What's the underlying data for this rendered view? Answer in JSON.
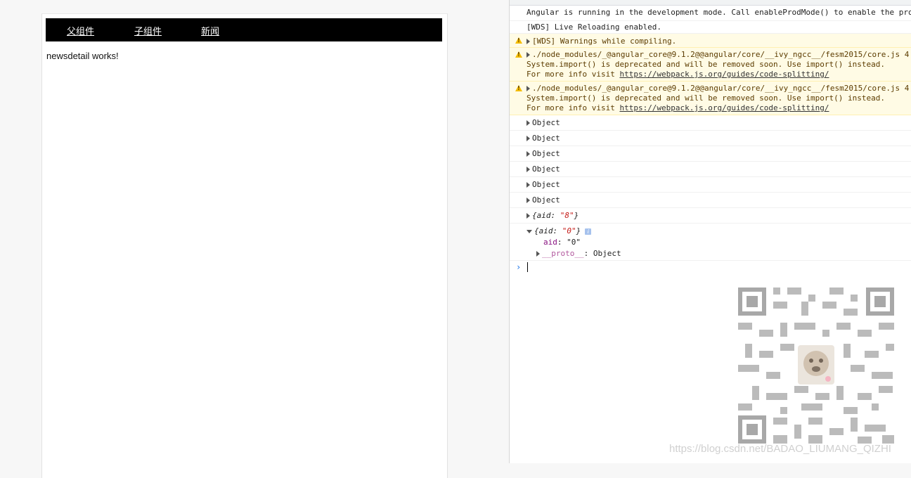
{
  "app": {
    "nav": {
      "parent_label": "父组件",
      "child_label": "子组件",
      "news_label": "新闻"
    },
    "content_text": "newsdetail works!"
  },
  "console": {
    "messages": {
      "dev_mode": "Angular is running in the development mode. Call enableProdMode() to enable the pro",
      "live_reload": "[WDS] Live Reloading enabled.",
      "wds_warnings": "[WDS] Warnings while compiling.",
      "warn1_line1": "./node_modules/_@angular_core@9.1.2@@angular/core/__ivy_ngcc__/fesm2015/core.js 4",
      "warn1_line2": "System.import() is deprecated and will be removed soon. Use import() instead.",
      "warn1_line3_prefix": "For more info visit ",
      "warn1_link": "https://webpack.js.org/guides/code-splitting/",
      "warn2_line1": "./node_modules/_@angular_core@9.1.2@@angular/core/__ivy_ngcc__/fesm2015/core.js 4",
      "warn2_line2": "System.import() is deprecated and will be removed soon. Use import() instead.",
      "warn2_line3_prefix": "For more info visit ",
      "warn2_link": "https://webpack.js.org/guides/code-splitting/",
      "objects": [
        "Object",
        "Object",
        "Object",
        "Object",
        "Object",
        "Object"
      ],
      "aid8_key": "{aid: ",
      "aid8_value": "\"8\"",
      "aid8_close": "}",
      "aid0_key": "{aid: ",
      "aid0_value": "\"0\"",
      "aid0_close": "}",
      "info_badge": "i",
      "prop_aid_key": "aid",
      "prop_aid_sep": ": ",
      "prop_aid_value": "\"0\"",
      "prop_proto_key": "__proto__",
      "prop_proto_sep": ": ",
      "prop_proto_value": "Object"
    },
    "prompt_symbol": "›"
  },
  "watermark": "https://blog.csdn.net/BADAO_LIUMANG_QIZHI"
}
